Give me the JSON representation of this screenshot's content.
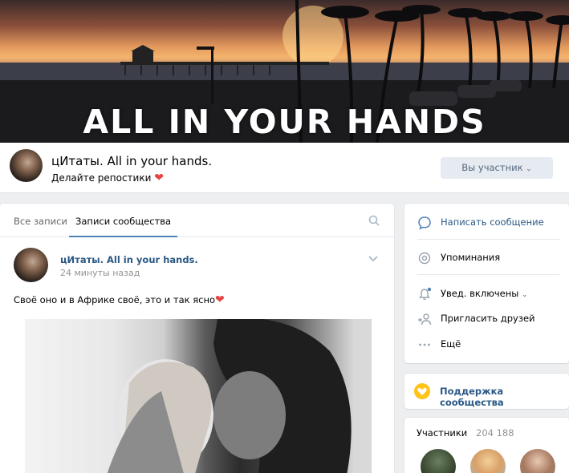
{
  "cover": {
    "title": "All in your hands"
  },
  "header": {
    "group_name": "цИтаты. All in your hands.",
    "status": "Делайте репостики",
    "member_button": "Вы участник"
  },
  "wall": {
    "tabs": [
      {
        "label": "Все записи"
      },
      {
        "label": "Записи сообщества"
      }
    ],
    "post": {
      "author": "цИтаты. All in your hands.",
      "time": "24 минуты назад",
      "text": "Своё оно и в Африке своё, это и так ясно"
    }
  },
  "menu": {
    "items": [
      {
        "label": "Написать сообщение",
        "icon": "message-icon"
      },
      {
        "label": "Упоминания",
        "icon": "at-icon"
      },
      {
        "label": "Увед. включены",
        "icon": "bell-icon"
      },
      {
        "label": "Пригласить друзей",
        "icon": "add-friend-icon"
      },
      {
        "label": "Ещё",
        "icon": "more-icon"
      }
    ]
  },
  "support": {
    "label": "Поддержка сообщества",
    "icon": "heart-coin-icon"
  },
  "members": {
    "title": "Участники",
    "count": "204 188"
  },
  "colors": {
    "link": "#2a5885",
    "accent": "#5181b8",
    "background": "#edeef0",
    "heart": "#e64646",
    "support": "#ffc319"
  }
}
